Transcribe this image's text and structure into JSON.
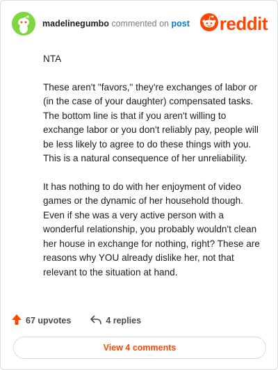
{
  "comment": {
    "username": "madelinegumbo",
    "commented_on": "commented on",
    "target": "post",
    "paragraphs": [
      "NTA",
      "These aren't \"favors,\" they're exchanges of labor or (in the case of your daughter) compensated tasks. The bottom line is that if you aren't willing to exchange labor or you don't reliably pay, people will be less likely to agree to do these things with you. This is a natural consequence of her unreliability.",
      "It has nothing to do with her enjoyment of video games or the dynamic of her household though. Even if she was a very active person with a wonderful relationship, you probably wouldn't clean her house in exchange for nothing, right? These are reasons why YOU already dislike her, not that relevant to the situation at hand."
    ]
  },
  "brand": {
    "name": "reddit",
    "color": "#ff4500"
  },
  "actions": {
    "upvotes": "67 upvotes",
    "replies": "4 replies"
  },
  "footer": {
    "view_comments": "View 4 comments"
  },
  "icons": {
    "avatar": "snoo-avatar-icon",
    "upvote": "upvote-arrow-icon",
    "reply": "reply-arrow-icon",
    "logo": "reddit-snoo-icon"
  }
}
